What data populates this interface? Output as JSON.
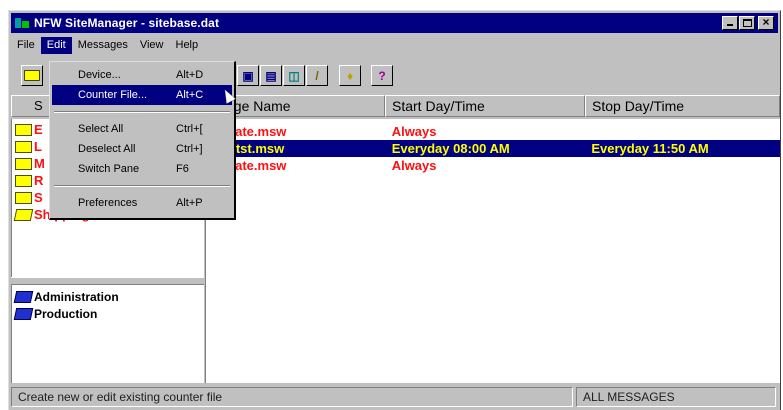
{
  "window": {
    "title": "NFW SiteManager - sitebase.dat"
  },
  "window_buttons": {
    "minimize_icon": "minimize-icon",
    "maximize_icon": "maximize-icon",
    "close_glyph": "×"
  },
  "menubar": [
    "File",
    "Edit",
    "Messages",
    "View",
    "Help"
  ],
  "toolbar": {
    "buttons": [
      "folder",
      "device",
      "counter",
      "display",
      "edit",
      "light",
      "key"
    ]
  },
  "left_pane": {
    "header_label": "S",
    "top_items": [
      {
        "label": "E",
        "color": "#ff1010"
      },
      {
        "label": "L",
        "color": "#ff1010"
      },
      {
        "label": "M",
        "color": "#ff1010"
      },
      {
        "label": "R",
        "color": "#ff1010"
      },
      {
        "label": "S",
        "color": "#ff1010"
      },
      {
        "label": "Shipping",
        "color": "#ff1010"
      }
    ],
    "bottom_items": [
      "Administration",
      "Production"
    ]
  },
  "message_list": {
    "columns": [
      "ssage Name",
      "Start Day/Time",
      "Stop Day/Time"
    ],
    "rows": [
      {
        "name": "nedate.msw",
        "start": "Always",
        "stop": "",
        "selected": false
      },
      {
        "name": "idthtst.msw",
        "start": "Everyday 08:00 AM",
        "stop": "Everyday 11:50 AM",
        "selected": true
      },
      {
        "name": "nimate.msw",
        "start": "Always",
        "stop": "",
        "selected": false
      }
    ]
  },
  "edit_menu": {
    "items": [
      {
        "label": "Device...",
        "accel": "Alt+D"
      },
      {
        "label": "Counter File...",
        "accel": "Alt+C",
        "highlighted": true
      },
      {
        "label": "Select All",
        "accel": "Ctrl+["
      },
      {
        "label": "Deselect All",
        "accel": "Ctrl+]"
      },
      {
        "label": "Switch Pane",
        "accel": "F6"
      },
      {
        "label": "Preferences",
        "accel": "Alt+P"
      }
    ]
  },
  "status": {
    "message": "Create new or edit existing counter file",
    "mode": "ALL MESSAGES"
  },
  "colors": {
    "title_bar": "#000080",
    "selection": "#000080",
    "text_red": "#ff1010",
    "selected_text": "#ffff00"
  }
}
